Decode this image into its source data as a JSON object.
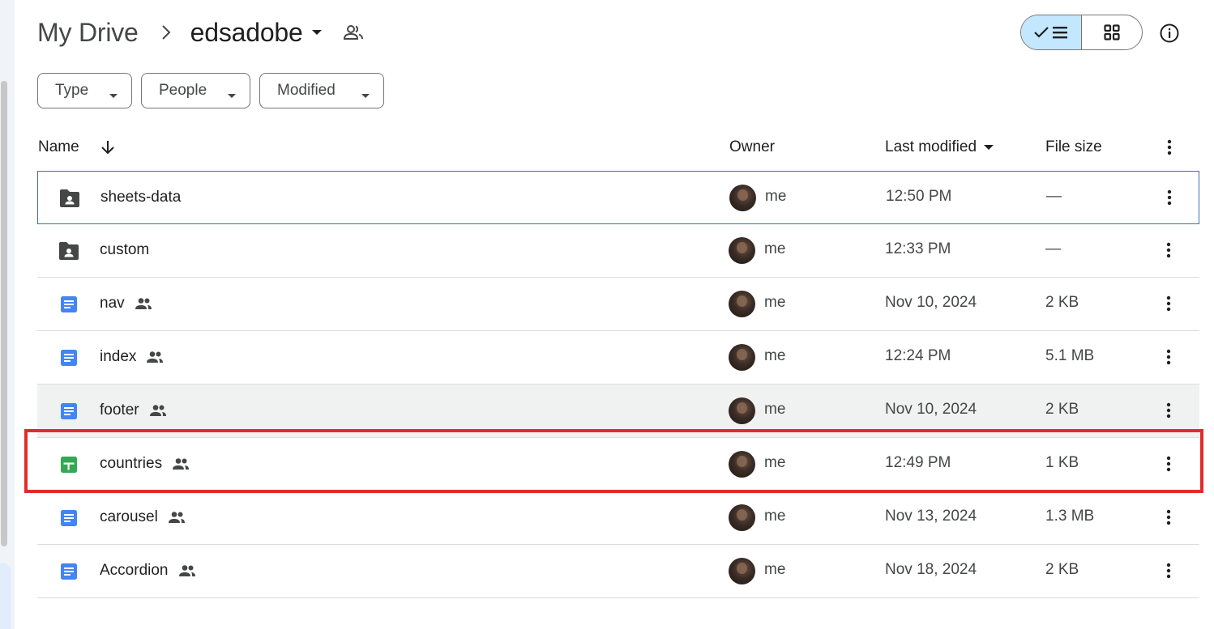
{
  "breadcrumb": {
    "root": "My Drive",
    "current": "edsadobe"
  },
  "filters": {
    "type_label": "Type",
    "people_label": "People",
    "modified_label": "Modified"
  },
  "columns": {
    "name": "Name",
    "owner": "Owner",
    "last_modified": "Last modified",
    "file_size": "File size"
  },
  "files": [
    {
      "name": "sheets-data",
      "icon": "shared-folder-icon",
      "shared": false,
      "owner": "me",
      "modified": "12:50 PM",
      "size": "—",
      "state": "selected"
    },
    {
      "name": "custom",
      "icon": "shared-folder-icon",
      "shared": false,
      "owner": "me",
      "modified": "12:33 PM",
      "size": "—",
      "state": "normal"
    },
    {
      "name": "nav",
      "icon": "google-docs-icon",
      "shared": true,
      "owner": "me",
      "modified": "Nov 10, 2024",
      "size": "2 KB",
      "state": "normal"
    },
    {
      "name": "index",
      "icon": "google-docs-icon",
      "shared": true,
      "owner": "me",
      "modified": "12:24 PM",
      "size": "5.1 MB",
      "state": "normal"
    },
    {
      "name": "footer",
      "icon": "google-docs-icon",
      "shared": true,
      "owner": "me",
      "modified": "Nov 10, 2024",
      "size": "2 KB",
      "state": "hover"
    },
    {
      "name": "countries",
      "icon": "google-sheets-icon",
      "shared": true,
      "owner": "me",
      "modified": "12:49 PM",
      "size": "1 KB",
      "state": "highlighted"
    },
    {
      "name": "carousel",
      "icon": "google-docs-icon",
      "shared": true,
      "owner": "me",
      "modified": "Nov 13, 2024",
      "size": "1.3 MB",
      "state": "normal"
    },
    {
      "name": "Accordion",
      "icon": "google-docs-icon",
      "shared": true,
      "owner": "me",
      "modified": "Nov 18, 2024",
      "size": "2 KB",
      "state": "normal"
    }
  ],
  "colors": {
    "docs_blue": "#4285f4",
    "sheets_green": "#34a853",
    "folder_gray": "#444746",
    "list_view_active": "#c2e7ff",
    "selection_border": "#3b6fb6",
    "annotation_red": "#e32b2b"
  },
  "view": {
    "active": "list"
  }
}
